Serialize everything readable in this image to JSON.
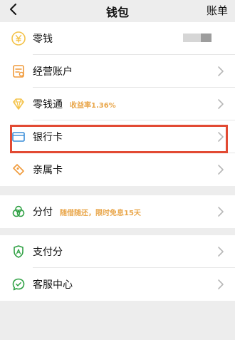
{
  "header": {
    "title": "钱包",
    "right_action": "账单"
  },
  "section1": {
    "items": [
      {
        "label": "零钱",
        "balance_masked": true
      },
      {
        "label": "经营账户"
      },
      {
        "label": "零钱通",
        "sub": "收益率1.36%"
      },
      {
        "label": "银行卡"
      },
      {
        "label": "亲属卡"
      }
    ]
  },
  "section2": {
    "items": [
      {
        "label": "分付",
        "sub": "随借随还，限时免息15天"
      }
    ]
  },
  "section3": {
    "items": [
      {
        "label": "支付分"
      },
      {
        "label": "客服中心"
      }
    ]
  },
  "colors": {
    "background": "#ededed",
    "card": "#ffffff",
    "icon_green": "#2ea043",
    "icon_yellow": "#f4c34a",
    "icon_orange": "#f09a3a",
    "icon_blue": "#3b8ed8",
    "accent_text": "#e9a64a",
    "highlight": "#e24a33"
  },
  "icons": {
    "back": "chevron-left-icon",
    "wallet_change": "yen-coin-icon",
    "business_account": "building-icon",
    "fund": "diamond-icon",
    "bank_card": "card-icon",
    "family_card": "tag-icon",
    "installment": "link-circles-icon",
    "score": "shield-a-icon",
    "service": "chat-check-icon"
  }
}
